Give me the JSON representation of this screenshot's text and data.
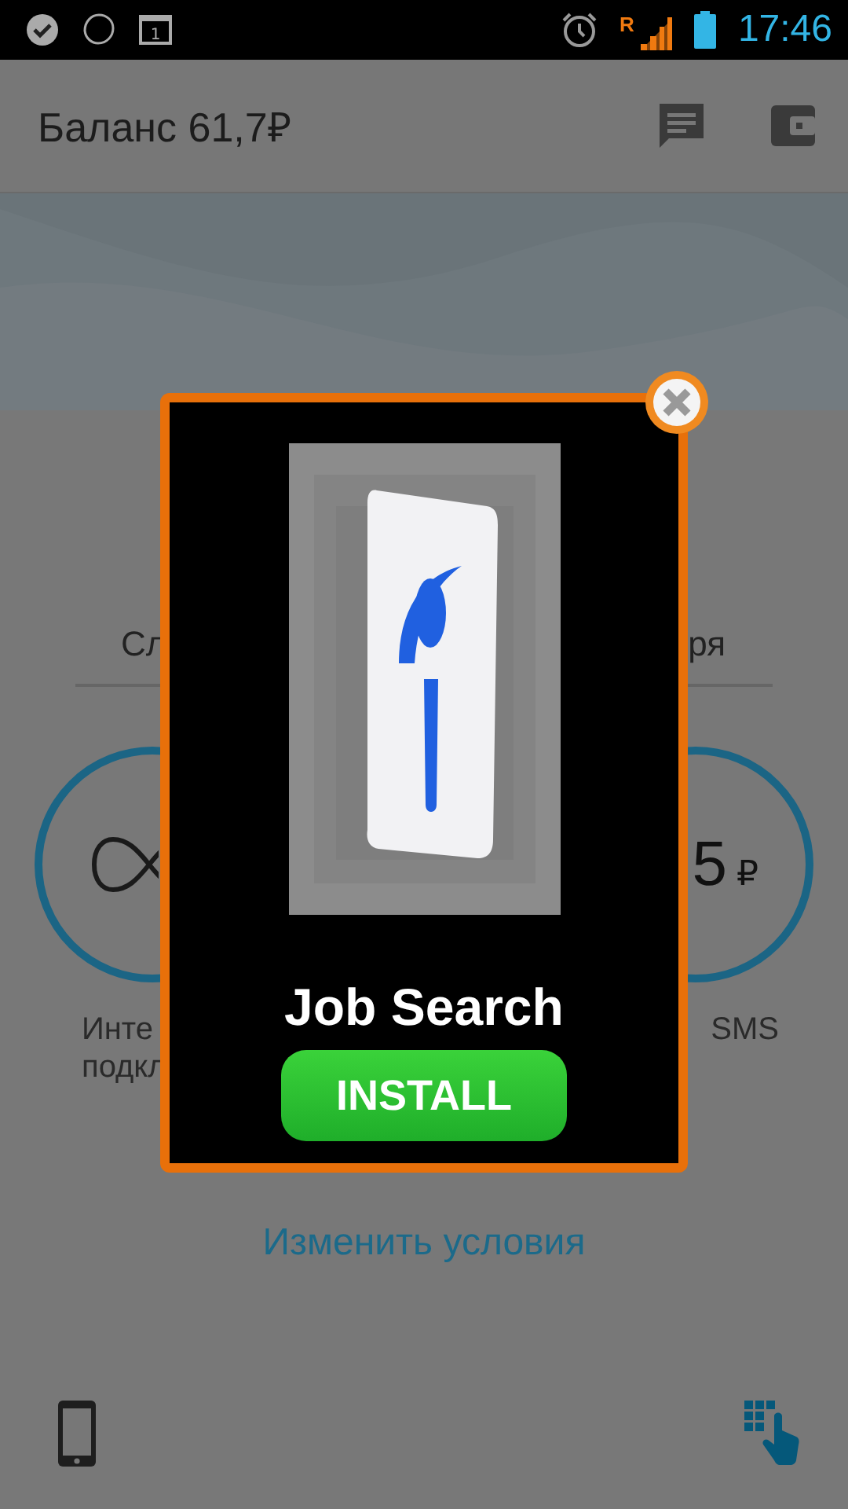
{
  "status_bar": {
    "calendar_day": "1",
    "roaming": "R",
    "time": "17:46"
  },
  "app_bar": {
    "title": "Баланс 61,7₽"
  },
  "tariff_row": {
    "left": "Сл",
    "right": "ря"
  },
  "circles": [
    {
      "kind": "unlimited",
      "label_lines": [
        "Инте",
        "подкл"
      ]
    },
    {
      "kind": "price",
      "value": "5",
      "unit": "₽",
      "label_lines": [
        "SMS"
      ]
    }
  ],
  "change_link": "Изменить условия",
  "ad": {
    "title": "Job Search",
    "button": "INSTALL"
  }
}
